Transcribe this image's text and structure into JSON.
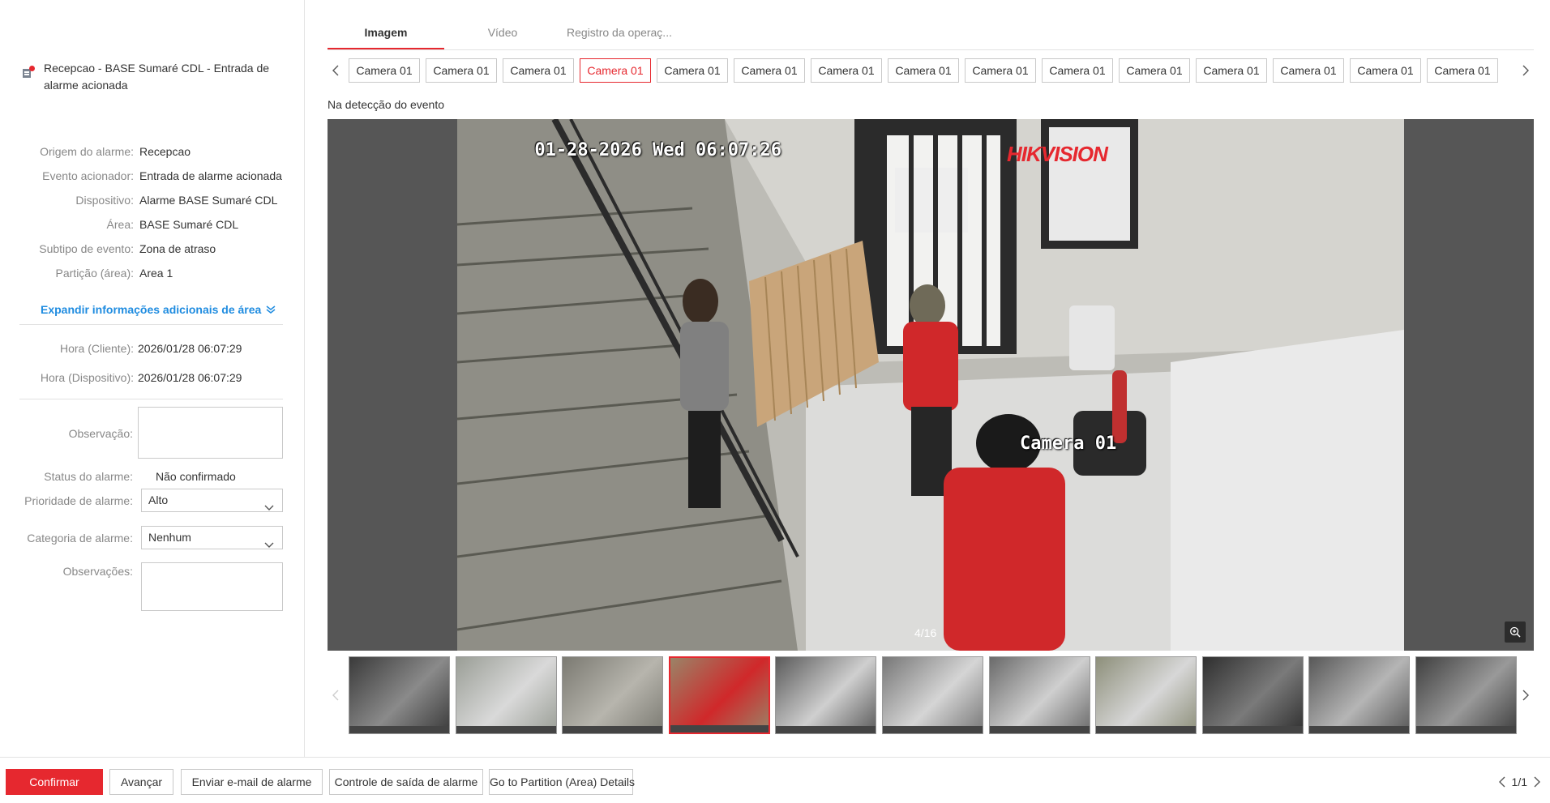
{
  "alarm": {
    "title": "Recepcao - BASE Sumaré CDL - Entrada de alarme acionada",
    "details": [
      {
        "label": "Origem do alarme:",
        "value": "Recepcao"
      },
      {
        "label": "Evento acionador:",
        "value": "Entrada de alarme acionada"
      },
      {
        "label": "Dispositivo:",
        "value": "Alarme BASE Sumaré CDL"
      },
      {
        "label": "Área:",
        "value": "BASE Sumaré CDL"
      },
      {
        "label": "Subtipo de evento:",
        "value": "Zona de atraso"
      },
      {
        "label": "Partição (área):",
        "value": "Area 1"
      }
    ],
    "expand_label": "Expandir informações adicionais de área",
    "times": [
      {
        "label": "Hora (Cliente):",
        "value": "2026/01/28 06:07:29"
      },
      {
        "label": "Hora (Dispositivo):",
        "value": "2026/01/28 06:07:29"
      }
    ]
  },
  "form": {
    "observation_label": "Observação:",
    "observation_value": "",
    "status_label": "Status do alarme:",
    "status_value": "Não confirmado",
    "priority_label": "Prioridade de alarme:",
    "priority_value": "Alto",
    "category_label": "Categoria de alarme:",
    "category_value": "Nenhum",
    "remarks_label": "Observações:",
    "remarks_value": ""
  },
  "tabs": [
    "Imagem",
    "Vídeo",
    "Registro da operaç..."
  ],
  "active_tab": 0,
  "cameras": [
    "Camera 01",
    "Camera 01",
    "Camera 01",
    "Camera 01",
    "Camera 01",
    "Camera 01",
    "Camera 01",
    "Camera 01",
    "Camera 01",
    "Camera 01",
    "Camera 01",
    "Camera 01",
    "Camera 01",
    "Camera 01",
    "Camera 01"
  ],
  "selected_camera": 3,
  "detect_label": "Na detecção do evento",
  "image": {
    "timestamp": "01-28-2026 Wed 06:07:26",
    "brand": "HIKVISION",
    "camera_name": "Camera 01",
    "counter": "4/16"
  },
  "thumbnails_count": 11,
  "selected_thumbnail": 3,
  "actions": {
    "confirm": "Confirmar",
    "next": "Avançar",
    "email": "Enviar e-mail de alarme",
    "output_control": "Controle de saída de alarme",
    "partition_details": "Go to Partition (Area) Details"
  },
  "pager": "1/1",
  "colors": {
    "accent": "#e6282f",
    "link": "#1f8ce0"
  }
}
